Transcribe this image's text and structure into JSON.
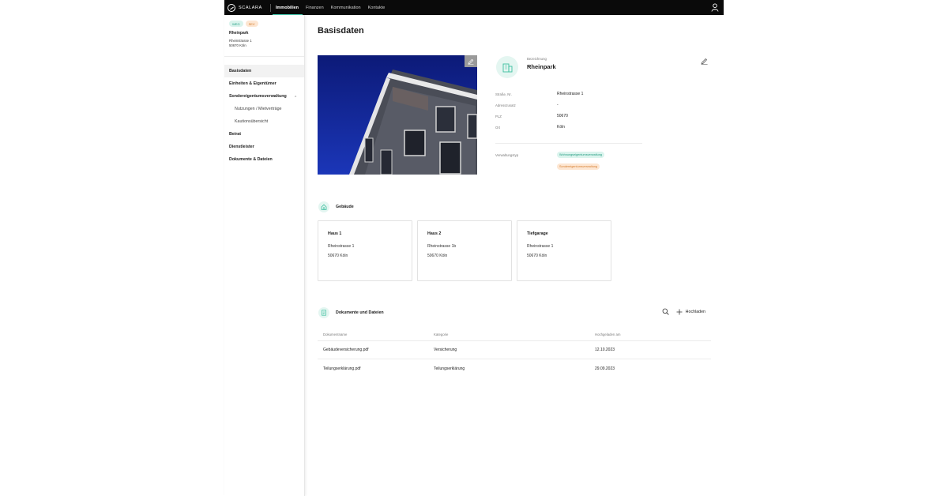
{
  "topbar": {
    "logo_text": "SCALARA",
    "nav": [
      "Immobilien",
      "Finanzen",
      "Kommunikation",
      "Kontakte"
    ],
    "active_index": 0
  },
  "sidebar": {
    "chips": [
      "WEG",
      "SEV"
    ],
    "property_name": "Rheinpark",
    "address_line1": "Rheinstrasse 1",
    "address_line2": "50670 Köln",
    "menu": [
      {
        "label": "Basisdaten",
        "type": "main",
        "active": true
      },
      {
        "label": "Einheiten & Eigentümer",
        "type": "main"
      },
      {
        "label": "Sondereigentumsverwaltung",
        "type": "main",
        "expanded": true
      },
      {
        "label": "Nutzungen / Mietverträge",
        "type": "sub"
      },
      {
        "label": "Kautionsübersicht",
        "type": "sub"
      },
      {
        "label": "Beirat",
        "type": "main"
      },
      {
        "label": "Dienstleister",
        "type": "main"
      },
      {
        "label": "Dokumente & Dateien",
        "type": "main"
      }
    ]
  },
  "main": {
    "title": "Basisdaten",
    "info": {
      "bezeichnung_label": "Bezeichnung",
      "bezeichnung_value": "Rheinpark",
      "fields": [
        {
          "label": "Straße, Nr.",
          "value": "Rheinstrasse 1"
        },
        {
          "label": "Adresszusatz",
          "value": "-"
        },
        {
          "label": "PLZ",
          "value": "50670"
        },
        {
          "label": "Ort",
          "value": "Köln"
        }
      ],
      "verwaltungstyp_label": "Verwaltungstyp",
      "verwaltungstyp_values": [
        "Wohnungseigentumsverwaltung",
        "Sondereigentumsverwaltung"
      ]
    },
    "buildings": {
      "title": "Gebäude",
      "cards": [
        {
          "name": "Haus 1",
          "street": "Rheinstrasse 1",
          "city": "50670 Köln"
        },
        {
          "name": "Haus 2",
          "street": "Rheinstrasse 1b",
          "city": "50670 Köln"
        },
        {
          "name": "Tiefgarage",
          "street": "Rheinstrasse 1",
          "city": "50670 Köln"
        }
      ]
    },
    "documents": {
      "title": "Dokumente und Dateien",
      "upload_label": "Hochladen",
      "columns": [
        "Dokumentname",
        "Kategorie",
        "Hochgeladen am"
      ],
      "rows": [
        [
          "Gebäudeversicherung.pdf",
          "Versicherung",
          "12.10.2023"
        ],
        [
          "Teilungserklärung.pdf",
          "Teilungserklärung",
          "29.09.2023"
        ]
      ]
    }
  },
  "colors": {
    "accent": "#4bd1b6",
    "weg_chip": "#d9f3ec",
    "sev_chip": "#fde6d2",
    "topbar": "#0a0a0a"
  }
}
